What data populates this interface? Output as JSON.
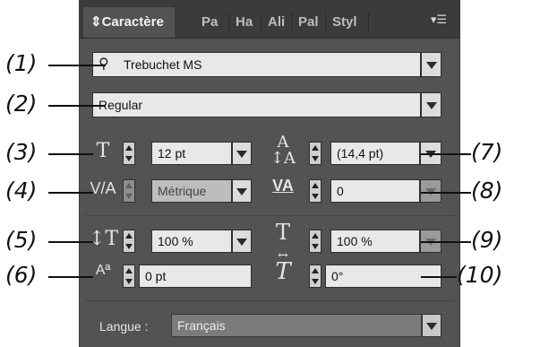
{
  "panel": {
    "tabs": [
      {
        "label": "Caractère",
        "active": true
      },
      {
        "label": "Pa",
        "active": false
      },
      {
        "label": "Ha",
        "active": false
      },
      {
        "label": "Ali",
        "active": false
      },
      {
        "label": "Pal",
        "active": false
      },
      {
        "label": "Styl",
        "active": false
      }
    ],
    "font_family": "Trebuchet MS",
    "font_style": "Regular",
    "font_size": "12 pt",
    "leading": "(14,4 pt)",
    "kerning": "Métrique",
    "tracking": "0",
    "vertical_scale": "100 %",
    "horizontal_scale": "100 %",
    "baseline_shift": "0 pt",
    "skew": "0°",
    "language_label": "Langue :",
    "language": "Français"
  },
  "callouts": [
    "(1)",
    "(2)",
    "(3)",
    "(4)",
    "(5)",
    "(6)",
    "(7)",
    "(8)",
    "(9)",
    "(10)"
  ],
  "colors": {
    "panel_bg": "#535353",
    "tabbar_bg": "#3b3b3b",
    "field_bg": "#e8e8e8",
    "text_light": "#e6e6e6"
  }
}
